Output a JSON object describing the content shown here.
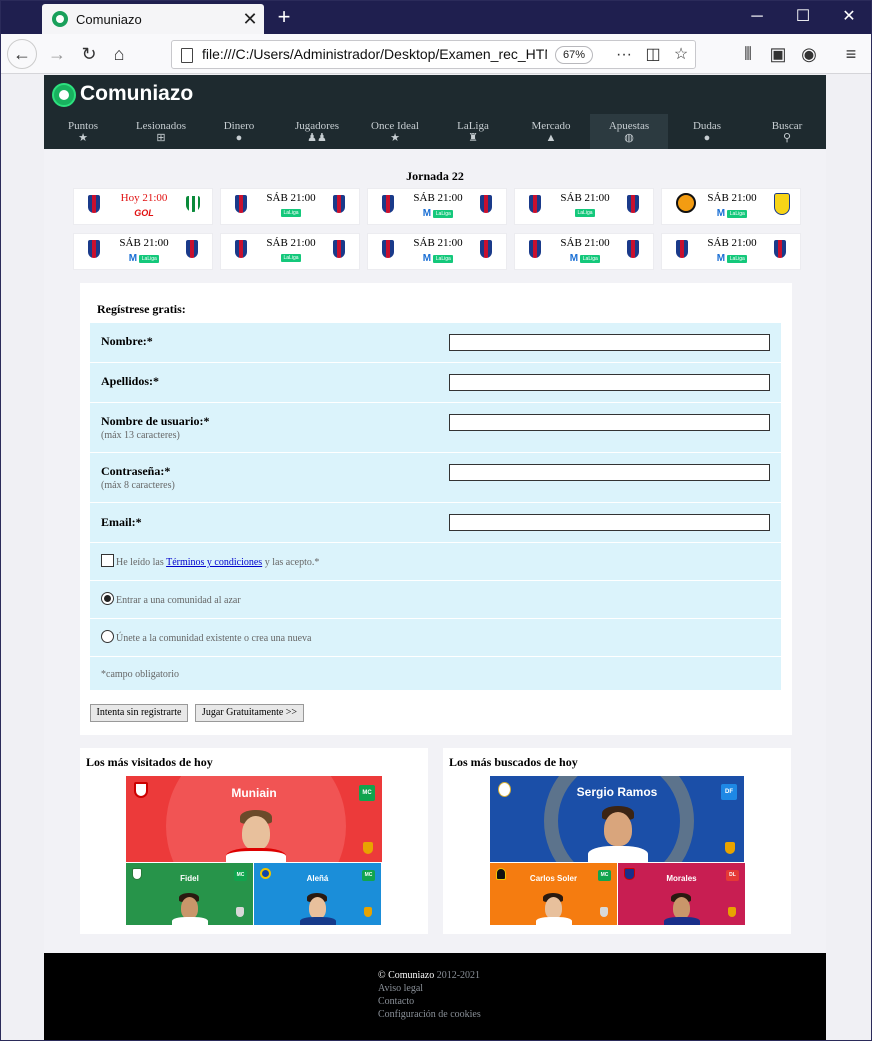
{
  "browser": {
    "tab_title": "Comuniazo",
    "url": "file:///C:/Users/Administrador/Desktop/Examen_rec_HTML",
    "zoom": "67%"
  },
  "site": {
    "logo": "Comuniazo",
    "menu": [
      {
        "label": "Puntos",
        "icon": "star-icon"
      },
      {
        "label": "Lesionados",
        "icon": "plus-square-icon"
      },
      {
        "label": "Dinero",
        "icon": "moneybag-icon"
      },
      {
        "label": "Jugadores",
        "icon": "users-icon"
      },
      {
        "label": "Once Ideal",
        "icon": "star-icon"
      },
      {
        "label": "LaLiga",
        "icon": "trophy-icon"
      },
      {
        "label": "Mercado",
        "icon": "chart-icon"
      },
      {
        "label": "Apuestas",
        "icon": "ball-icon"
      },
      {
        "label": "Dudas",
        "icon": "chat-icon"
      },
      {
        "label": "Buscar",
        "icon": "search-icon"
      }
    ],
    "active_menu": "Apuestas"
  },
  "fixtures": {
    "title": "Jornada 22",
    "matches": [
      {
        "time": "Hoy 21:00",
        "tv": "GOL"
      },
      {
        "time": "SÁB 21:00",
        "tv": "LaLiga"
      },
      {
        "time": "SÁB 21:00",
        "tv": "M LaLiga"
      },
      {
        "time": "SÁB 21:00",
        "tv": "LaLiga"
      },
      {
        "time": "SÁB 21:00",
        "tv": "M LaLiga"
      },
      {
        "time": "SÁB 21:00",
        "tv": "M LaLiga"
      },
      {
        "time": "SÁB 21:00",
        "tv": "LaLiga"
      },
      {
        "time": "SÁB 21:00",
        "tv": "M LaLiga"
      },
      {
        "time": "SÁB 21:00",
        "tv": "M LaLiga"
      },
      {
        "time": "SÁB 21:00",
        "tv": "M LaLiga"
      }
    ]
  },
  "form": {
    "title": "Regístrese gratis:",
    "nombre_label": "Nombre:*",
    "apellidos_label": "Apellidos:*",
    "usuario_label": "Nombre de usuario:*",
    "usuario_hint": "(máx 13 caracteres)",
    "password_label": "Contraseña:*",
    "password_hint": "(máx 8 caracteres)",
    "email_label": "Email:*",
    "terms_before": "He leído las ",
    "terms_link": "Términos y condiciones",
    "terms_after": " y las acepto.*",
    "radio_random": "Entrar a una comunidad al azar",
    "radio_existing": "Únete a la comunidad existente o crea una nueva",
    "required_note": "*campo obligatorio",
    "btn_try": "Intenta sin registrarte",
    "btn_play": "Jugar Gratuitamente >>"
  },
  "most_visited": {
    "title": "Los más visitados de hoy",
    "main": {
      "name": "Muniain",
      "pos": "MC"
    },
    "others": [
      {
        "name": "Fidel",
        "pos": "MC"
      },
      {
        "name": "Aleñá",
        "pos": "MC"
      }
    ]
  },
  "most_searched": {
    "title": "Los más buscados de hoy",
    "main": {
      "name": "Sergio Ramos",
      "pos": "DF"
    },
    "others": [
      {
        "name": "Carlos Soler",
        "pos": "MC"
      },
      {
        "name": "Morales",
        "pos": "DL"
      }
    ]
  },
  "footer": {
    "copyright_symbol": "©",
    "brand": "Comuniazo",
    "years": "2012-2021",
    "links": [
      "Aviso legal",
      "Contacto",
      "Configuración de cookies"
    ]
  },
  "colors": {
    "header": "#1e2a2f",
    "row": "#dbf3fb",
    "live": "#e11010",
    "accent": "#19b25f"
  }
}
